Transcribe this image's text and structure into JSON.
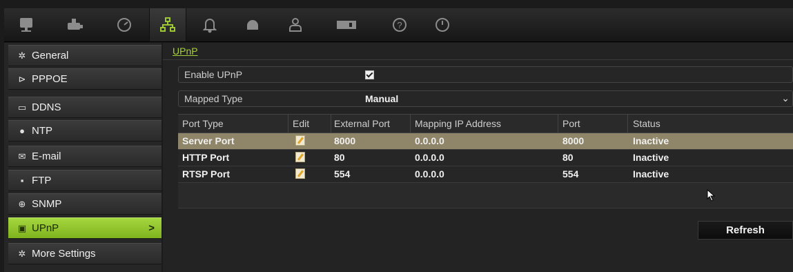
{
  "toolbar": {
    "items": [
      {
        "icon": "monitor-icon"
      },
      {
        "icon": "camera-icon"
      },
      {
        "icon": "gauge-icon"
      },
      {
        "icon": "network-icon",
        "active": true
      },
      {
        "icon": "bell-icon"
      },
      {
        "icon": "dome-camera-icon"
      },
      {
        "icon": "user-icon"
      },
      {
        "icon": "hdd-icon"
      },
      {
        "icon": "help-icon"
      },
      {
        "icon": "power-icon"
      }
    ],
    "accent": "#9ec832"
  },
  "sidebar": {
    "items": [
      {
        "label": "General",
        "icon": "gear-icon"
      },
      {
        "label": "PPPOE",
        "icon": "plug-icon"
      },
      {
        "label": "DDNS",
        "icon": "ddns-icon"
      },
      {
        "label": "NTP",
        "icon": "clock-icon"
      },
      {
        "label": "E-mail",
        "icon": "mail-icon"
      },
      {
        "label": "FTP",
        "icon": "ftp-icon"
      },
      {
        "label": "SNMP",
        "icon": "globe-icon"
      },
      {
        "label": "UPnP",
        "icon": "upnp-icon",
        "active": true,
        "chevron": ">"
      },
      {
        "label": "More Settings",
        "icon": "settings-icon"
      }
    ],
    "active_color": "#96c831"
  },
  "main": {
    "breadcrumb": "UPnP",
    "enable_upnp": {
      "label": "Enable UPnP",
      "checked": true
    },
    "mapped_type": {
      "label": "Mapped Type",
      "value": "Manual"
    },
    "table": {
      "headers": [
        "Port Type",
        "Edit",
        "External Port",
        "Mapping IP Address",
        "Port",
        "Status"
      ],
      "rows": [
        {
          "port_type": "Server Port",
          "external_port": "8000",
          "mapping_ip": "0.0.0.0",
          "port": "8000",
          "status": "Inactive",
          "selected": true
        },
        {
          "port_type": "HTTP Port",
          "external_port": "80",
          "mapping_ip": "0.0.0.0",
          "port": "80",
          "status": "Inactive"
        },
        {
          "port_type": "RTSP Port",
          "external_port": "554",
          "mapping_ip": "0.0.0.0",
          "port": "554",
          "status": "Inactive"
        }
      ]
    },
    "refresh_label": "Refresh"
  }
}
